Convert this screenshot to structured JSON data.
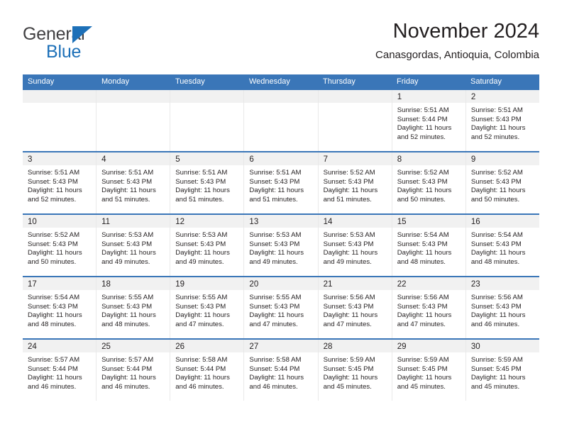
{
  "brand": {
    "name_part1": "General",
    "name_part2": "Blue",
    "accent_color": "#1d70b8",
    "triangle_icon": "brand-triangle-icon"
  },
  "header": {
    "title": "November 2024",
    "subtitle": "Canasgordas, Antioquia, Colombia"
  },
  "calendar": {
    "header_bg": "#3a76b8",
    "day_band_bg": "#f1f1f1",
    "weekdays": [
      "Sunday",
      "Monday",
      "Tuesday",
      "Wednesday",
      "Thursday",
      "Friday",
      "Saturday"
    ],
    "weeks": [
      [
        {
          "day": "",
          "sunrise": "",
          "sunset": "",
          "daylight": ""
        },
        {
          "day": "",
          "sunrise": "",
          "sunset": "",
          "daylight": ""
        },
        {
          "day": "",
          "sunrise": "",
          "sunset": "",
          "daylight": ""
        },
        {
          "day": "",
          "sunrise": "",
          "sunset": "",
          "daylight": ""
        },
        {
          "day": "",
          "sunrise": "",
          "sunset": "",
          "daylight": ""
        },
        {
          "day": "1",
          "sunrise": "Sunrise: 5:51 AM",
          "sunset": "Sunset: 5:44 PM",
          "daylight": "Daylight: 11 hours and 52 minutes."
        },
        {
          "day": "2",
          "sunrise": "Sunrise: 5:51 AM",
          "sunset": "Sunset: 5:43 PM",
          "daylight": "Daylight: 11 hours and 52 minutes."
        }
      ],
      [
        {
          "day": "3",
          "sunrise": "Sunrise: 5:51 AM",
          "sunset": "Sunset: 5:43 PM",
          "daylight": "Daylight: 11 hours and 52 minutes."
        },
        {
          "day": "4",
          "sunrise": "Sunrise: 5:51 AM",
          "sunset": "Sunset: 5:43 PM",
          "daylight": "Daylight: 11 hours and 51 minutes."
        },
        {
          "day": "5",
          "sunrise": "Sunrise: 5:51 AM",
          "sunset": "Sunset: 5:43 PM",
          "daylight": "Daylight: 11 hours and 51 minutes."
        },
        {
          "day": "6",
          "sunrise": "Sunrise: 5:51 AM",
          "sunset": "Sunset: 5:43 PM",
          "daylight": "Daylight: 11 hours and 51 minutes."
        },
        {
          "day": "7",
          "sunrise": "Sunrise: 5:52 AM",
          "sunset": "Sunset: 5:43 PM",
          "daylight": "Daylight: 11 hours and 51 minutes."
        },
        {
          "day": "8",
          "sunrise": "Sunrise: 5:52 AM",
          "sunset": "Sunset: 5:43 PM",
          "daylight": "Daylight: 11 hours and 50 minutes."
        },
        {
          "day": "9",
          "sunrise": "Sunrise: 5:52 AM",
          "sunset": "Sunset: 5:43 PM",
          "daylight": "Daylight: 11 hours and 50 minutes."
        }
      ],
      [
        {
          "day": "10",
          "sunrise": "Sunrise: 5:52 AM",
          "sunset": "Sunset: 5:43 PM",
          "daylight": "Daylight: 11 hours and 50 minutes."
        },
        {
          "day": "11",
          "sunrise": "Sunrise: 5:53 AM",
          "sunset": "Sunset: 5:43 PM",
          "daylight": "Daylight: 11 hours and 49 minutes."
        },
        {
          "day": "12",
          "sunrise": "Sunrise: 5:53 AM",
          "sunset": "Sunset: 5:43 PM",
          "daylight": "Daylight: 11 hours and 49 minutes."
        },
        {
          "day": "13",
          "sunrise": "Sunrise: 5:53 AM",
          "sunset": "Sunset: 5:43 PM",
          "daylight": "Daylight: 11 hours and 49 minutes."
        },
        {
          "day": "14",
          "sunrise": "Sunrise: 5:53 AM",
          "sunset": "Sunset: 5:43 PM",
          "daylight": "Daylight: 11 hours and 49 minutes."
        },
        {
          "day": "15",
          "sunrise": "Sunrise: 5:54 AM",
          "sunset": "Sunset: 5:43 PM",
          "daylight": "Daylight: 11 hours and 48 minutes."
        },
        {
          "day": "16",
          "sunrise": "Sunrise: 5:54 AM",
          "sunset": "Sunset: 5:43 PM",
          "daylight": "Daylight: 11 hours and 48 minutes."
        }
      ],
      [
        {
          "day": "17",
          "sunrise": "Sunrise: 5:54 AM",
          "sunset": "Sunset: 5:43 PM",
          "daylight": "Daylight: 11 hours and 48 minutes."
        },
        {
          "day": "18",
          "sunrise": "Sunrise: 5:55 AM",
          "sunset": "Sunset: 5:43 PM",
          "daylight": "Daylight: 11 hours and 48 minutes."
        },
        {
          "day": "19",
          "sunrise": "Sunrise: 5:55 AM",
          "sunset": "Sunset: 5:43 PM",
          "daylight": "Daylight: 11 hours and 47 minutes."
        },
        {
          "day": "20",
          "sunrise": "Sunrise: 5:55 AM",
          "sunset": "Sunset: 5:43 PM",
          "daylight": "Daylight: 11 hours and 47 minutes."
        },
        {
          "day": "21",
          "sunrise": "Sunrise: 5:56 AM",
          "sunset": "Sunset: 5:43 PM",
          "daylight": "Daylight: 11 hours and 47 minutes."
        },
        {
          "day": "22",
          "sunrise": "Sunrise: 5:56 AM",
          "sunset": "Sunset: 5:43 PM",
          "daylight": "Daylight: 11 hours and 47 minutes."
        },
        {
          "day": "23",
          "sunrise": "Sunrise: 5:56 AM",
          "sunset": "Sunset: 5:43 PM",
          "daylight": "Daylight: 11 hours and 46 minutes."
        }
      ],
      [
        {
          "day": "24",
          "sunrise": "Sunrise: 5:57 AM",
          "sunset": "Sunset: 5:44 PM",
          "daylight": "Daylight: 11 hours and 46 minutes."
        },
        {
          "day": "25",
          "sunrise": "Sunrise: 5:57 AM",
          "sunset": "Sunset: 5:44 PM",
          "daylight": "Daylight: 11 hours and 46 minutes."
        },
        {
          "day": "26",
          "sunrise": "Sunrise: 5:58 AM",
          "sunset": "Sunset: 5:44 PM",
          "daylight": "Daylight: 11 hours and 46 minutes."
        },
        {
          "day": "27",
          "sunrise": "Sunrise: 5:58 AM",
          "sunset": "Sunset: 5:44 PM",
          "daylight": "Daylight: 11 hours and 46 minutes."
        },
        {
          "day": "28",
          "sunrise": "Sunrise: 5:59 AM",
          "sunset": "Sunset: 5:45 PM",
          "daylight": "Daylight: 11 hours and 45 minutes."
        },
        {
          "day": "29",
          "sunrise": "Sunrise: 5:59 AM",
          "sunset": "Sunset: 5:45 PM",
          "daylight": "Daylight: 11 hours and 45 minutes."
        },
        {
          "day": "30",
          "sunrise": "Sunrise: 5:59 AM",
          "sunset": "Sunset: 5:45 PM",
          "daylight": "Daylight: 11 hours and 45 minutes."
        }
      ]
    ]
  }
}
